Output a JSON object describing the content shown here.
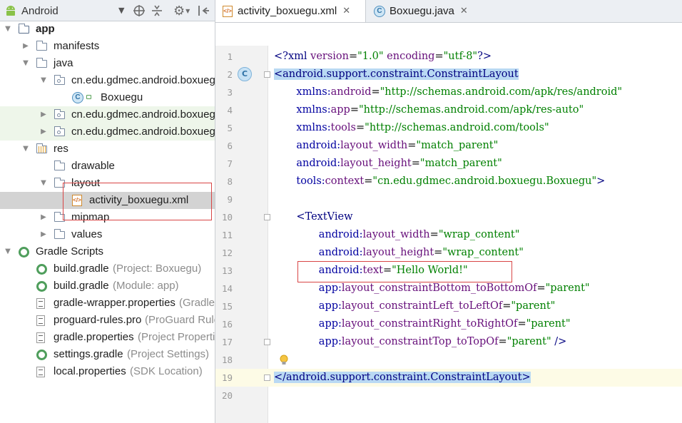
{
  "project_panel": {
    "view_selector": "Android",
    "tree": [
      {
        "label": "app",
        "bold": true,
        "indent": 0,
        "arrow": "down",
        "icon": "module-folder-icon"
      },
      {
        "label": "manifests",
        "indent": 1,
        "arrow": "right",
        "icon": "folder-icon"
      },
      {
        "label": "java",
        "indent": 1,
        "arrow": "down",
        "icon": "folder-icon"
      },
      {
        "label": "cn.edu.gdmec.android.boxuegu",
        "indent": 2,
        "arrow": "down",
        "icon": "package-icon"
      },
      {
        "label": "Boxuegu",
        "indent": 3,
        "arrow": "",
        "icon": "class-icon"
      },
      {
        "label": "cn.edu.gdmec.android.boxuegu",
        "indent": 2,
        "arrow": "right",
        "icon": "package-icon",
        "green": true
      },
      {
        "label": "cn.edu.gdmec.android.boxuegu",
        "indent": 2,
        "arrow": "right",
        "icon": "package-icon",
        "green": true
      },
      {
        "label": "res",
        "indent": 1,
        "arrow": "down",
        "icon": "res-folder-icon"
      },
      {
        "label": "drawable",
        "indent": 2,
        "arrow": "",
        "icon": "folder-icon"
      },
      {
        "label": "layout",
        "indent": 2,
        "arrow": "down",
        "icon": "folder-icon"
      },
      {
        "label": "activity_boxuegu.xml",
        "indent": 3,
        "arrow": "",
        "icon": "xml-file-icon",
        "selected": true
      },
      {
        "label": "mipmap",
        "indent": 2,
        "arrow": "right",
        "icon": "folder-icon"
      },
      {
        "label": "values",
        "indent": 2,
        "arrow": "right",
        "icon": "folder-icon"
      },
      {
        "label": "Gradle Scripts",
        "indent": 0,
        "arrow": "down",
        "icon": "gradle-icon"
      },
      {
        "label": "build.gradle",
        "sub": "(Project: Boxuegu)",
        "indent": 1,
        "arrow": "",
        "icon": "gradle-icon"
      },
      {
        "label": "build.gradle",
        "sub": "(Module: app)",
        "indent": 1,
        "arrow": "",
        "icon": "gradle-icon"
      },
      {
        "label": "gradle-wrapper.properties",
        "sub": "(Gradle Version)",
        "indent": 1,
        "arrow": "",
        "icon": "properties-file-icon"
      },
      {
        "label": "proguard-rules.pro",
        "sub": "(ProGuard Rules for app)",
        "indent": 1,
        "arrow": "",
        "icon": "text-file-icon"
      },
      {
        "label": "gradle.properties",
        "sub": "(Project Properties)",
        "indent": 1,
        "arrow": "",
        "icon": "properties-file-icon"
      },
      {
        "label": "settings.gradle",
        "sub": "(Project Settings)",
        "indent": 1,
        "arrow": "",
        "icon": "gradle-icon"
      },
      {
        "label": "local.properties",
        "sub": "(SDK Location)",
        "indent": 1,
        "arrow": "",
        "icon": "properties-file-icon"
      }
    ]
  },
  "editor": {
    "tabs": [
      {
        "label": "activity_boxuegu.xml",
        "active": true,
        "icon": "xml-file-icon"
      },
      {
        "label": "Boxuegu.java",
        "active": false,
        "icon": "class-icon"
      }
    ],
    "line_numbers": [
      "1",
      "2",
      "3",
      "4",
      "5",
      "6",
      "7",
      "8",
      "9",
      "10",
      "11",
      "12",
      "13",
      "14",
      "15",
      "16",
      "17",
      "18",
      "19",
      "20"
    ],
    "lines": [
      {
        "indent": 0,
        "tokens": [
          {
            "t": "<?",
            "c": "tag"
          },
          {
            "t": "xml ",
            "c": "tag"
          },
          {
            "t": "version",
            "c": "attr"
          },
          {
            "t": "=",
            "c": ""
          },
          {
            "t": "\"1.0\"",
            "c": "val"
          },
          {
            "t": " ",
            "c": ""
          },
          {
            "t": "encoding",
            "c": "attr"
          },
          {
            "t": "=",
            "c": ""
          },
          {
            "t": "\"utf-8\"",
            "c": "val"
          },
          {
            "t": "?>",
            "c": "tag"
          }
        ]
      },
      {
        "indent": 0,
        "tokens": [
          {
            "t": "<android.support.constraint.ConstraintLayout",
            "c": "tag mark"
          }
        ]
      },
      {
        "indent": 4,
        "tokens": [
          {
            "t": "xmlns:",
            "c": "ns"
          },
          {
            "t": "android",
            "c": "attr"
          },
          {
            "t": "=",
            "c": ""
          },
          {
            "t": "\"http://schemas.android.com/apk/res/android\"",
            "c": "val"
          }
        ]
      },
      {
        "indent": 4,
        "tokens": [
          {
            "t": "xmlns:",
            "c": "ns"
          },
          {
            "t": "app",
            "c": "attr"
          },
          {
            "t": "=",
            "c": ""
          },
          {
            "t": "\"http://schemas.android.com/apk/res-auto\"",
            "c": "val"
          }
        ]
      },
      {
        "indent": 4,
        "tokens": [
          {
            "t": "xmlns:",
            "c": "ns"
          },
          {
            "t": "tools",
            "c": "attr"
          },
          {
            "t": "=",
            "c": ""
          },
          {
            "t": "\"http://schemas.android.com/tools\"",
            "c": "val"
          }
        ]
      },
      {
        "indent": 4,
        "tokens": [
          {
            "t": "android:",
            "c": "ns"
          },
          {
            "t": "layout_width",
            "c": "attr"
          },
          {
            "t": "=",
            "c": ""
          },
          {
            "t": "\"match_parent\"",
            "c": "val"
          }
        ]
      },
      {
        "indent": 4,
        "tokens": [
          {
            "t": "android:",
            "c": "ns"
          },
          {
            "t": "layout_height",
            "c": "attr"
          },
          {
            "t": "=",
            "c": ""
          },
          {
            "t": "\"match_parent\"",
            "c": "val"
          }
        ]
      },
      {
        "indent": 4,
        "tokens": [
          {
            "t": "tools:",
            "c": "ns"
          },
          {
            "t": "context",
            "c": "attr"
          },
          {
            "t": "=",
            "c": ""
          },
          {
            "t": "\"cn.edu.gdmec.android.boxuegu.Boxuegu\"",
            "c": "val"
          },
          {
            "t": ">",
            "c": "tag"
          }
        ]
      },
      {
        "indent": 0,
        "tokens": []
      },
      {
        "indent": 4,
        "tokens": [
          {
            "t": "<TextView",
            "c": "tag"
          }
        ]
      },
      {
        "indent": 8,
        "tokens": [
          {
            "t": "android:",
            "c": "ns"
          },
          {
            "t": "layout_width",
            "c": "attr"
          },
          {
            "t": "=",
            "c": ""
          },
          {
            "t": "\"wrap_content\"",
            "c": "val"
          }
        ]
      },
      {
        "indent": 8,
        "tokens": [
          {
            "t": "android:",
            "c": "ns"
          },
          {
            "t": "layout_height",
            "c": "attr"
          },
          {
            "t": "=",
            "c": ""
          },
          {
            "t": "\"wrap_content\"",
            "c": "val"
          }
        ]
      },
      {
        "indent": 8,
        "tokens": [
          {
            "t": "android:",
            "c": "ns"
          },
          {
            "t": "text",
            "c": "attr"
          },
          {
            "t": "=",
            "c": ""
          },
          {
            "t": "\"Hello World!\"",
            "c": "val"
          }
        ]
      },
      {
        "indent": 8,
        "tokens": [
          {
            "t": "app:",
            "c": "ns"
          },
          {
            "t": "layout_constraintBottom_toBottomOf",
            "c": "attr"
          },
          {
            "t": "=",
            "c": ""
          },
          {
            "t": "\"parent\"",
            "c": "val"
          }
        ]
      },
      {
        "indent": 8,
        "tokens": [
          {
            "t": "app:",
            "c": "ns"
          },
          {
            "t": "layout_constraintLeft_toLeftOf",
            "c": "attr"
          },
          {
            "t": "=",
            "c": ""
          },
          {
            "t": "\"parent\"",
            "c": "val"
          }
        ]
      },
      {
        "indent": 8,
        "tokens": [
          {
            "t": "app:",
            "c": "ns"
          },
          {
            "t": "layout_constraintRight_toRightOf",
            "c": "attr"
          },
          {
            "t": "=",
            "c": ""
          },
          {
            "t": "\"parent\"",
            "c": "val"
          }
        ]
      },
      {
        "indent": 8,
        "tokens": [
          {
            "t": "app:",
            "c": "ns"
          },
          {
            "t": "layout_constraintTop_toTopOf",
            "c": "attr"
          },
          {
            "t": "=",
            "c": ""
          },
          {
            "t": "\"parent\"",
            "c": "val"
          },
          {
            "t": " />",
            "c": "tag"
          }
        ]
      },
      {
        "indent": 0,
        "tokens": []
      },
      {
        "indent": 0,
        "tokens": [
          {
            "t": "</android.support.constraint.ConstraintLayout>",
            "c": "tag mark"
          }
        ],
        "highlight": true
      },
      {
        "indent": 0,
        "tokens": []
      }
    ],
    "gutter_class_marker": "C"
  },
  "colors": {
    "tag": "#000080",
    "attr": "#660e7a",
    "value": "#008000",
    "selection": "#b9d9f3",
    "annotation_box": "#d84545"
  }
}
